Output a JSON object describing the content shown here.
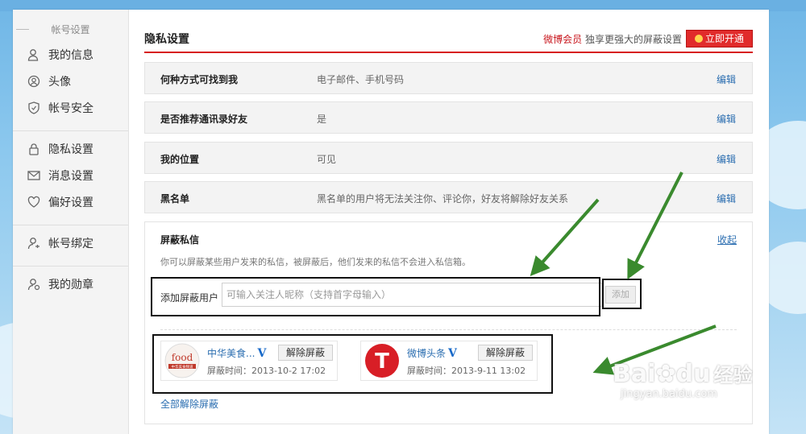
{
  "sidebar": {
    "heading": "帐号设置",
    "groups": [
      [
        {
          "label": "我的信息",
          "icon": "user-icon"
        },
        {
          "label": "头像",
          "icon": "avatar-icon"
        },
        {
          "label": "帐号安全",
          "icon": "shield-icon"
        }
      ],
      [
        {
          "label": "隐私设置",
          "icon": "lock-icon"
        },
        {
          "label": "消息设置",
          "icon": "message-icon"
        },
        {
          "label": "偏好设置",
          "icon": "heart-gear-icon"
        }
      ],
      [
        {
          "label": "帐号绑定",
          "icon": "bind-icon"
        }
      ],
      [
        {
          "label": "我的勋章",
          "icon": "medal-icon"
        }
      ]
    ]
  },
  "header": {
    "title": "隐私设置",
    "vip_link": "微博会员",
    "vip_text": " 独享更强大的屏蔽设置",
    "vip_button": "立即开通"
  },
  "rows": [
    {
      "label": "何种方式可找到我",
      "value": "电子邮件、手机号码",
      "edit": "编辑"
    },
    {
      "label": "是否推荐通讯录好友",
      "value": "是",
      "edit": "编辑"
    },
    {
      "label": "我的位置",
      "value": "可见",
      "edit": "编辑"
    },
    {
      "label": "黑名单",
      "value": "黑名单的用户将无法关注你、评论你，好友将解除好友关系",
      "edit": "编辑"
    }
  ],
  "block_panel": {
    "title": "屏蔽私信",
    "collapse": "收起",
    "description": "你可以屏蔽某些用户发来的私信，被屏蔽后，他们发来的私信不会进入私信箱。",
    "add_label": "添加屏蔽用户",
    "input_placeholder": "可输入关注人昵称（支持首字母输入）",
    "input_value": "",
    "add_button": "添加",
    "users": [
      {
        "name": "中华美食...",
        "verified": "V",
        "unblock": "解除屏蔽",
        "time": "屏蔽时间：2013-10-2 17:02",
        "avatar_text": "food",
        "avatar_sub": "中华美食频道"
      },
      {
        "name": "微博头条",
        "verified": "V",
        "unblock": "解除屏蔽",
        "time": "屏蔽时间：2013-9-11 13:02",
        "avatar_text": "T",
        "avatar_sub": ""
      }
    ],
    "unblock_all": "全部解除屏蔽"
  },
  "watermark": {
    "brand_a": "Bai",
    "brand_b": "du",
    "brand_cn": "经验",
    "url": "jingyan.baidu.com"
  },
  "colors": {
    "accent_red": "#d71f1f",
    "link_blue": "#2a6db0",
    "annotation_arrow": "#3a8a2e"
  }
}
